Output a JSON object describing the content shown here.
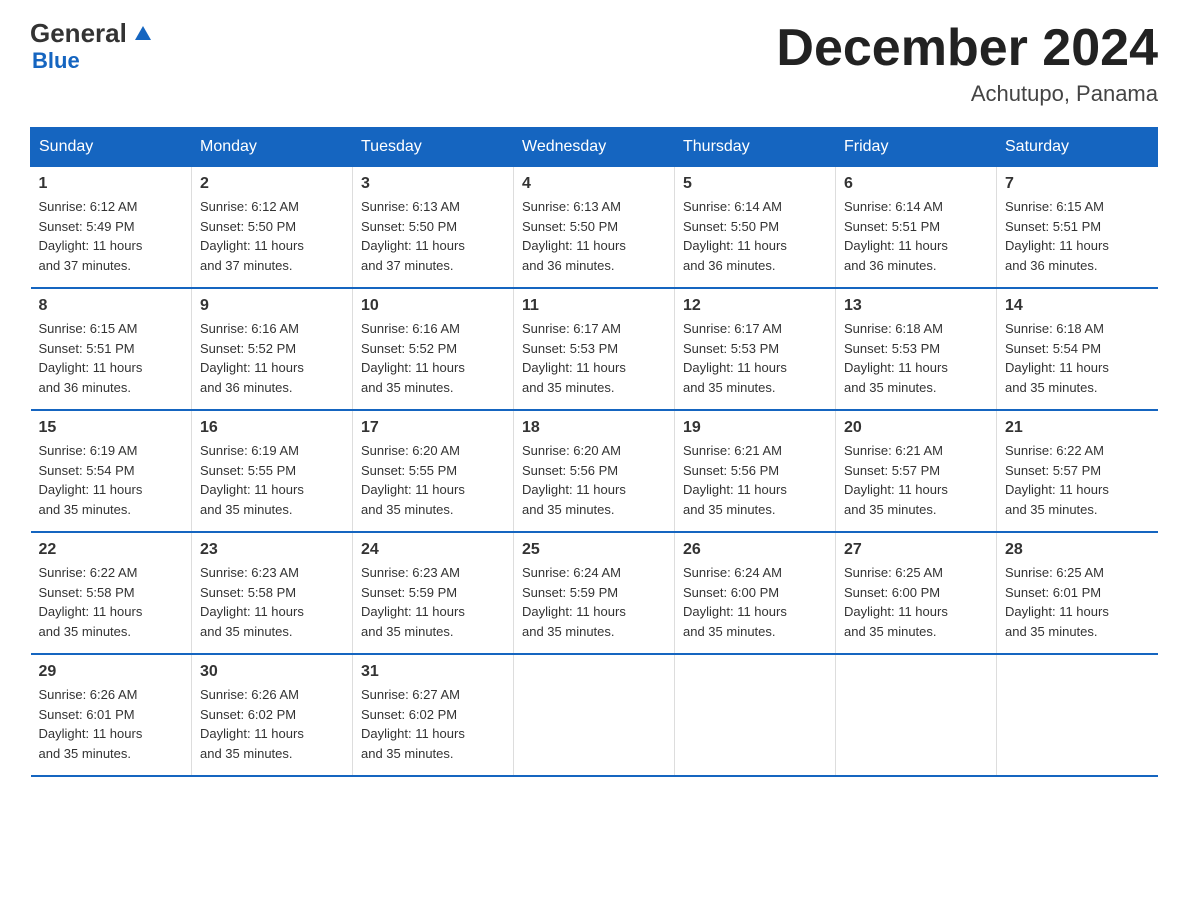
{
  "logo": {
    "general": "General",
    "blue": "Blue",
    "triangle_char": "▶"
  },
  "header": {
    "month_year": "December 2024",
    "location": "Achutupo, Panama"
  },
  "weekdays": [
    "Sunday",
    "Monday",
    "Tuesday",
    "Wednesday",
    "Thursday",
    "Friday",
    "Saturday"
  ],
  "weeks": [
    [
      {
        "day": "1",
        "sunrise": "6:12 AM",
        "sunset": "5:49 PM",
        "daylight": "11 hours and 37 minutes."
      },
      {
        "day": "2",
        "sunrise": "6:12 AM",
        "sunset": "5:50 PM",
        "daylight": "11 hours and 37 minutes."
      },
      {
        "day": "3",
        "sunrise": "6:13 AM",
        "sunset": "5:50 PM",
        "daylight": "11 hours and 37 minutes."
      },
      {
        "day": "4",
        "sunrise": "6:13 AM",
        "sunset": "5:50 PM",
        "daylight": "11 hours and 36 minutes."
      },
      {
        "day": "5",
        "sunrise": "6:14 AM",
        "sunset": "5:50 PM",
        "daylight": "11 hours and 36 minutes."
      },
      {
        "day": "6",
        "sunrise": "6:14 AM",
        "sunset": "5:51 PM",
        "daylight": "11 hours and 36 minutes."
      },
      {
        "day": "7",
        "sunrise": "6:15 AM",
        "sunset": "5:51 PM",
        "daylight": "11 hours and 36 minutes."
      }
    ],
    [
      {
        "day": "8",
        "sunrise": "6:15 AM",
        "sunset": "5:51 PM",
        "daylight": "11 hours and 36 minutes."
      },
      {
        "day": "9",
        "sunrise": "6:16 AM",
        "sunset": "5:52 PM",
        "daylight": "11 hours and 36 minutes."
      },
      {
        "day": "10",
        "sunrise": "6:16 AM",
        "sunset": "5:52 PM",
        "daylight": "11 hours and 35 minutes."
      },
      {
        "day": "11",
        "sunrise": "6:17 AM",
        "sunset": "5:53 PM",
        "daylight": "11 hours and 35 minutes."
      },
      {
        "day": "12",
        "sunrise": "6:17 AM",
        "sunset": "5:53 PM",
        "daylight": "11 hours and 35 minutes."
      },
      {
        "day": "13",
        "sunrise": "6:18 AM",
        "sunset": "5:53 PM",
        "daylight": "11 hours and 35 minutes."
      },
      {
        "day": "14",
        "sunrise": "6:18 AM",
        "sunset": "5:54 PM",
        "daylight": "11 hours and 35 minutes."
      }
    ],
    [
      {
        "day": "15",
        "sunrise": "6:19 AM",
        "sunset": "5:54 PM",
        "daylight": "11 hours and 35 minutes."
      },
      {
        "day": "16",
        "sunrise": "6:19 AM",
        "sunset": "5:55 PM",
        "daylight": "11 hours and 35 minutes."
      },
      {
        "day": "17",
        "sunrise": "6:20 AM",
        "sunset": "5:55 PM",
        "daylight": "11 hours and 35 minutes."
      },
      {
        "day": "18",
        "sunrise": "6:20 AM",
        "sunset": "5:56 PM",
        "daylight": "11 hours and 35 minutes."
      },
      {
        "day": "19",
        "sunrise": "6:21 AM",
        "sunset": "5:56 PM",
        "daylight": "11 hours and 35 minutes."
      },
      {
        "day": "20",
        "sunrise": "6:21 AM",
        "sunset": "5:57 PM",
        "daylight": "11 hours and 35 minutes."
      },
      {
        "day": "21",
        "sunrise": "6:22 AM",
        "sunset": "5:57 PM",
        "daylight": "11 hours and 35 minutes."
      }
    ],
    [
      {
        "day": "22",
        "sunrise": "6:22 AM",
        "sunset": "5:58 PM",
        "daylight": "11 hours and 35 minutes."
      },
      {
        "day": "23",
        "sunrise": "6:23 AM",
        "sunset": "5:58 PM",
        "daylight": "11 hours and 35 minutes."
      },
      {
        "day": "24",
        "sunrise": "6:23 AM",
        "sunset": "5:59 PM",
        "daylight": "11 hours and 35 minutes."
      },
      {
        "day": "25",
        "sunrise": "6:24 AM",
        "sunset": "5:59 PM",
        "daylight": "11 hours and 35 minutes."
      },
      {
        "day": "26",
        "sunrise": "6:24 AM",
        "sunset": "6:00 PM",
        "daylight": "11 hours and 35 minutes."
      },
      {
        "day": "27",
        "sunrise": "6:25 AM",
        "sunset": "6:00 PM",
        "daylight": "11 hours and 35 minutes."
      },
      {
        "day": "28",
        "sunrise": "6:25 AM",
        "sunset": "6:01 PM",
        "daylight": "11 hours and 35 minutes."
      }
    ],
    [
      {
        "day": "29",
        "sunrise": "6:26 AM",
        "sunset": "6:01 PM",
        "daylight": "11 hours and 35 minutes."
      },
      {
        "day": "30",
        "sunrise": "6:26 AM",
        "sunset": "6:02 PM",
        "daylight": "11 hours and 35 minutes."
      },
      {
        "day": "31",
        "sunrise": "6:27 AM",
        "sunset": "6:02 PM",
        "daylight": "11 hours and 35 minutes."
      },
      null,
      null,
      null,
      null
    ]
  ],
  "labels": {
    "sunrise": "Sunrise:",
    "sunset": "Sunset:",
    "daylight": "Daylight:"
  }
}
